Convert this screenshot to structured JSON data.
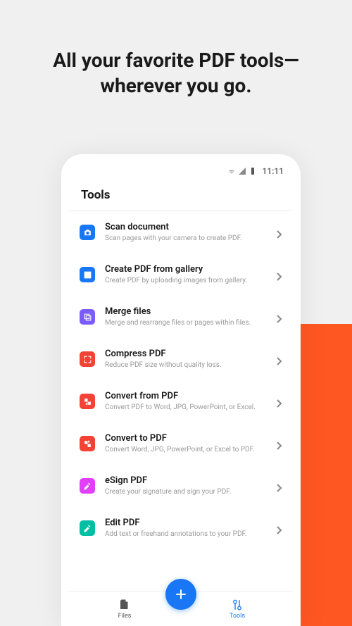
{
  "headline": "All your favorite PDF tools—wherever you go.",
  "status": {
    "time": "11:11"
  },
  "header": {
    "title": "Tools"
  },
  "tools": [
    {
      "title": "Scan document",
      "desc": "Scan pages with your camera to create PDF.",
      "color": "blue",
      "icon": "camera"
    },
    {
      "title": "Create PDF from gallery",
      "desc": "Create PDF by uploading images from gallery.",
      "color": "blue",
      "icon": "image"
    },
    {
      "title": "Merge files",
      "desc": "Merge and rearrange files or pages within files.",
      "color": "purple",
      "icon": "merge"
    },
    {
      "title": "Compress PDF",
      "desc": "Reduce PDF size without quality loss.",
      "color": "red",
      "icon": "compress"
    },
    {
      "title": "Convert from PDF",
      "desc": "Convert PDF to Word, JPG, PowerPoint, or Excel.",
      "color": "red",
      "icon": "convert-from"
    },
    {
      "title": "Convert to PDF",
      "desc": "Convert Word, JPG, PowerPoint, or Excel to PDF.",
      "color": "red",
      "icon": "convert-to"
    },
    {
      "title": "eSign PDF",
      "desc": "Create your signature and sign your PDF.",
      "color": "pink",
      "icon": "sign"
    },
    {
      "title": "Edit PDF",
      "desc": "Add text or freehand annotations to your PDF.",
      "color": "teal",
      "icon": "edit"
    }
  ],
  "nav": {
    "files": "Files",
    "tools": "Tools"
  }
}
